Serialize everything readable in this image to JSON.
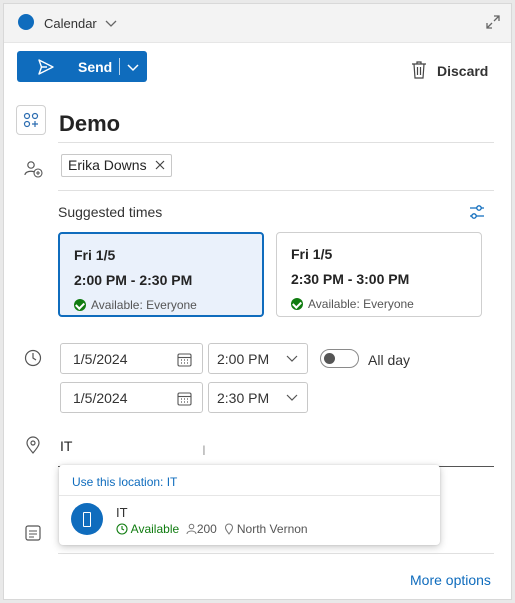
{
  "header": {
    "calendar_label": "Calendar"
  },
  "toolbar": {
    "send_label": "Send",
    "discard_label": "Discard"
  },
  "event": {
    "title": "Demo"
  },
  "attendees": [
    "Erika Downs"
  ],
  "suggested": {
    "label": "Suggested times",
    "cards": [
      {
        "date": "Fri 1/5",
        "time": "2:00 PM - 2:30 PM",
        "availability": "Available: Everyone",
        "selected": true
      },
      {
        "date": "Fri 1/5",
        "time": "2:30 PM - 3:00 PM",
        "availability": "Available: Everyone",
        "selected": false
      }
    ]
  },
  "schedule": {
    "start_date": "1/5/2024",
    "start_time": "2:00 PM",
    "end_date": "1/5/2024",
    "end_time": "2:30 PM",
    "all_day_label": "All day",
    "all_day": false
  },
  "location": {
    "value": "IT",
    "suggestion_header": "Use this location: IT",
    "room": {
      "name": "IT",
      "availability": "Available",
      "capacity": "200",
      "place": "North Vernon"
    }
  },
  "footer": {
    "more_options": "More options"
  },
  "colors": {
    "accent": "#0f6cbd",
    "available": "#107c10"
  }
}
